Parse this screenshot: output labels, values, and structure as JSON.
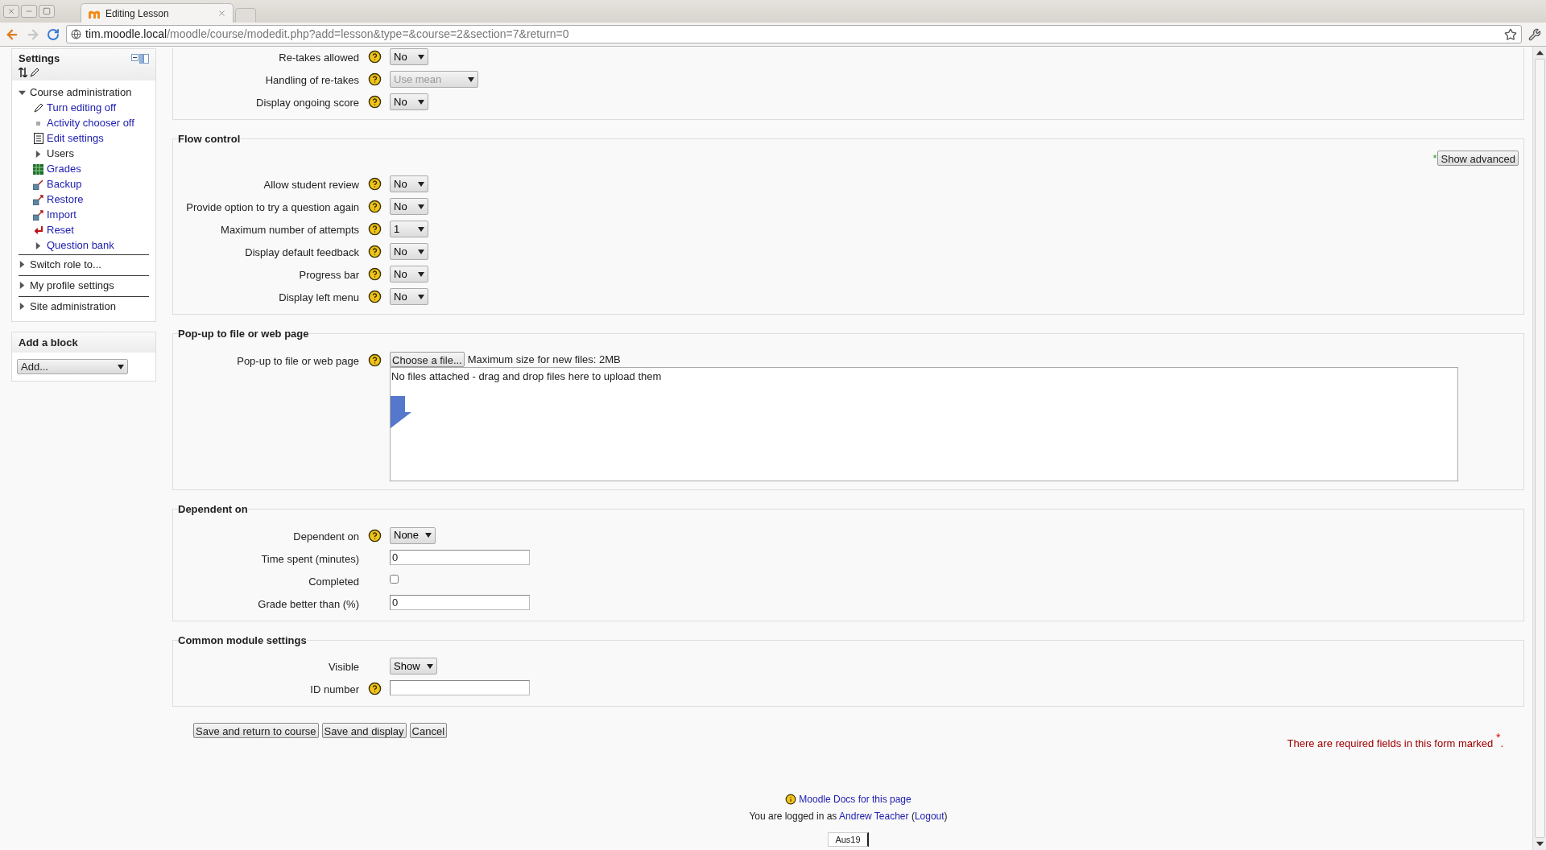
{
  "browser": {
    "tab_title": "Editing Lesson",
    "url_host": "tim.moodle.local",
    "url_path": "/moodle/course/modedit.php?add=lesson&type=&course=2&section=7&return=0"
  },
  "sidebar": {
    "title": "Settings",
    "course_admin": {
      "label": "Course administration",
      "expanded": true,
      "children": [
        {
          "label": "Turn editing off",
          "kind": "link"
        },
        {
          "label": "Activity chooser off",
          "kind": "link"
        },
        {
          "label": "Edit settings",
          "kind": "link"
        },
        {
          "label": "Users",
          "kind": "folder"
        },
        {
          "label": "Grades",
          "kind": "link"
        },
        {
          "label": "Backup",
          "kind": "link"
        },
        {
          "label": "Restore",
          "kind": "link"
        },
        {
          "label": "Import",
          "kind": "link"
        },
        {
          "label": "Reset",
          "kind": "link"
        },
        {
          "label": "Question bank",
          "kind": "linkfolder"
        }
      ]
    },
    "nodes": [
      {
        "label": "Switch role to...",
        "expanded": false
      },
      {
        "label": "My profile settings",
        "expanded": false
      },
      {
        "label": "Site administration",
        "expanded": false
      }
    ],
    "add_block": {
      "title": "Add a block",
      "select": "Add..."
    }
  },
  "sections": [
    {
      "rows": [
        {
          "label": "Re-takes allowed",
          "help": true,
          "kind": "select",
          "value": "No",
          "disabled": false
        },
        {
          "label": "Handling of re-takes",
          "help": true,
          "kind": "select",
          "value": "Use mean",
          "disabled": true
        },
        {
          "label": "Display ongoing score",
          "help": true,
          "kind": "select",
          "value": "No",
          "disabled": false
        }
      ]
    },
    {
      "legend": "Flow control",
      "show_advanced": {
        "mark": "*",
        "label": "Show advanced"
      },
      "rows": [
        {
          "label": "Allow student review",
          "help": true,
          "kind": "select",
          "value": "No",
          "disabled": false
        },
        {
          "label": "Provide option to try a question again",
          "help": true,
          "kind": "select",
          "value": "No",
          "disabled": false
        },
        {
          "label": "Maximum number of attempts",
          "help": true,
          "kind": "select",
          "value": "1",
          "disabled": false
        },
        {
          "label": "Display default feedback",
          "help": true,
          "kind": "select",
          "value": "No",
          "disabled": false
        },
        {
          "label": "Progress bar",
          "help": true,
          "kind": "select",
          "value": "No",
          "disabled": false
        },
        {
          "label": "Display left menu",
          "help": true,
          "kind": "select",
          "value": "No",
          "disabled": false
        }
      ]
    },
    {
      "legend": "Pop-up to file or web page",
      "rows": [
        {
          "label": "Pop-up to file or web page",
          "help": true,
          "kind": "filepicker",
          "button": "Choose a file...",
          "note": "Maximum size for new files: 2MB",
          "drop_text": "No files attached - drag and drop files here to upload them"
        }
      ]
    },
    {
      "legend": "Dependent on",
      "rows": [
        {
          "label": "Dependent on",
          "help": true,
          "kind": "select",
          "value": "None",
          "disabled": false
        },
        {
          "label": "Time spent (minutes)",
          "help": false,
          "kind": "text",
          "value": "0"
        },
        {
          "label": "Completed",
          "help": false,
          "kind": "checkbox",
          "checked": false
        },
        {
          "label": "Grade better than (%)",
          "help": false,
          "kind": "text",
          "value": "0"
        }
      ]
    },
    {
      "legend": "Common module settings",
      "rows": [
        {
          "label": "Visible",
          "help": false,
          "kind": "select",
          "value": "Show",
          "disabled": false
        },
        {
          "label": "ID number",
          "help": true,
          "kind": "text",
          "value": ""
        }
      ]
    }
  ],
  "buttons": [
    "Save and return to course",
    "Save and display",
    "Cancel"
  ],
  "required_note": "There are required fields in this form marked $^{*}$.",
  "footer": {
    "docs_link": "Moodle Docs for this page",
    "logged_in": [
      {
        "kind": "text",
        "text": "You are logged in as "
      },
      {
        "kind": "link",
        "text": "Andrew Teacher"
      },
      {
        "kind": "text",
        "text": " ("
      },
      {
        "kind": "link",
        "text": "Logout"
      },
      {
        "kind": "text",
        "text": ")"
      }
    ],
    "widget": "Aus19"
  }
}
